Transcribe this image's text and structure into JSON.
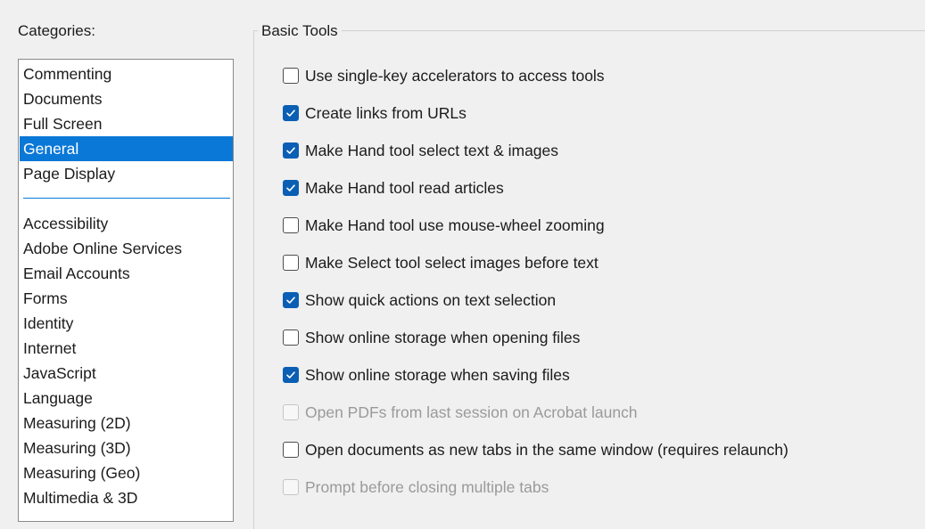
{
  "categories": {
    "label": "Categories:",
    "top_items": [
      {
        "label": "Commenting"
      },
      {
        "label": "Documents"
      },
      {
        "label": "Full Screen"
      },
      {
        "label": "General",
        "selected": true
      },
      {
        "label": "Page Display"
      }
    ],
    "other_items": [
      {
        "label": "Accessibility"
      },
      {
        "label": "Adobe Online Services"
      },
      {
        "label": "Email Accounts"
      },
      {
        "label": "Forms"
      },
      {
        "label": "Identity"
      },
      {
        "label": "Internet"
      },
      {
        "label": "JavaScript"
      },
      {
        "label": "Language"
      },
      {
        "label": "Measuring (2D)"
      },
      {
        "label": "Measuring (3D)"
      },
      {
        "label": "Measuring (Geo)"
      },
      {
        "label": "Multimedia & 3D"
      }
    ]
  },
  "basic_tools": {
    "title": "Basic Tools",
    "options": [
      {
        "label": "Use single-key accelerators to access tools",
        "checked": false,
        "enabled": true
      },
      {
        "label": "Create links from URLs",
        "checked": true,
        "enabled": true
      },
      {
        "label": "Make Hand tool select text & images",
        "checked": true,
        "enabled": true
      },
      {
        "label": "Make Hand tool read articles",
        "checked": true,
        "enabled": true
      },
      {
        "label": "Make Hand tool use mouse-wheel zooming",
        "checked": false,
        "enabled": true
      },
      {
        "label": "Make Select tool select images before text",
        "checked": false,
        "enabled": true
      },
      {
        "label": "Show quick actions on text selection",
        "checked": true,
        "enabled": true
      },
      {
        "label": "Show online storage when opening files",
        "checked": false,
        "enabled": true
      },
      {
        "label": "Show online storage when saving files",
        "checked": true,
        "enabled": true
      },
      {
        "label": "Open PDFs from last session on Acrobat launch",
        "checked": false,
        "enabled": false
      },
      {
        "label": "Open documents as new tabs in the same window (requires relaunch)",
        "checked": false,
        "enabled": true
      },
      {
        "label": "Prompt before closing multiple tabs",
        "checked": false,
        "enabled": false
      }
    ]
  },
  "colors": {
    "selection": "#0a78d7",
    "checkbox_checked": "#0a5fb4",
    "disabled_text": "#9a9a9a",
    "background": "#f0f0f0"
  }
}
